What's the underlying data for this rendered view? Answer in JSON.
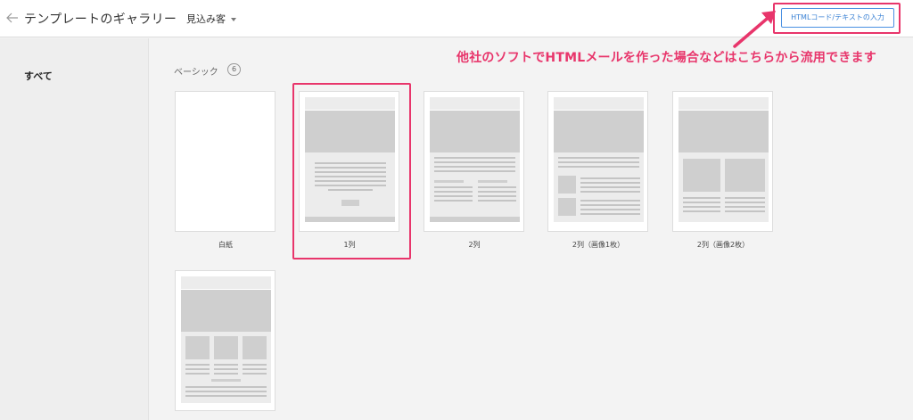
{
  "header": {
    "back_icon": "arrow-left-icon",
    "title": "テンプレートのギャラリー",
    "audience_dropdown": "見込み客",
    "html_button": "HTMLコード/テキストの入力"
  },
  "sidebar": {
    "items": [
      {
        "label": "すべて"
      }
    ]
  },
  "annotation": {
    "text": "他社のソフトでHTMLメールを作った場合などはこちらから流用できます",
    "color": "#e8356b"
  },
  "section": {
    "title": "ベーシック",
    "count": "6"
  },
  "templates": [
    {
      "label": "白紙"
    },
    {
      "label": "1列"
    },
    {
      "label": "2列"
    },
    {
      "label": "2列（画像1枚）"
    },
    {
      "label": "2列（画像2枚）"
    },
    {
      "label": ""
    }
  ],
  "colors": {
    "accent": "#e8356b",
    "link_blue": "#3b82d4"
  }
}
